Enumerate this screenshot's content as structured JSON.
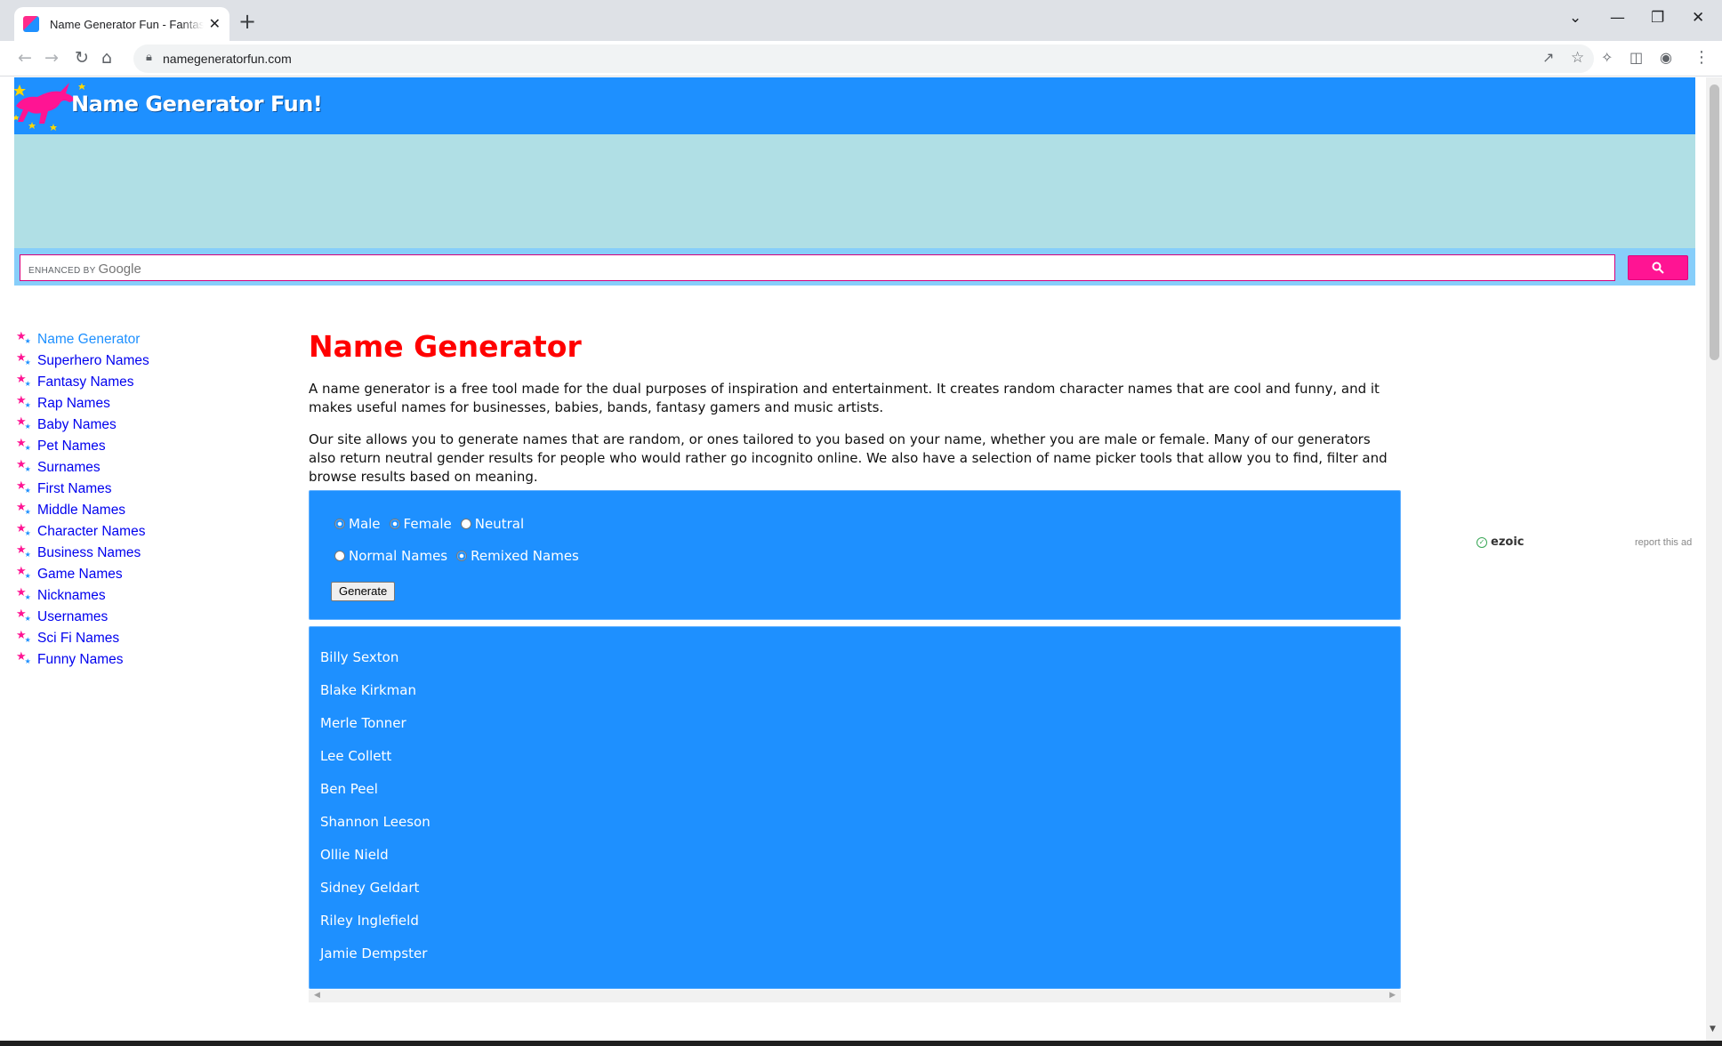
{
  "browser": {
    "tab_title": "Name Generator Fun - Fantasy and ...",
    "tab_close": "✕",
    "new_tab": "+",
    "url": "namegeneratorfun.com",
    "win_controls": {
      "dropdown": "⌄",
      "minimize": "—",
      "restore": "❐",
      "close": "✕"
    },
    "icons": [
      "back-icon",
      "forward-icon",
      "reload-icon",
      "home-icon",
      "lock-icon",
      "share-icon",
      "star-icon",
      "extensions-icon",
      "side-panel-icon",
      "profile-icon",
      "menu-icon"
    ]
  },
  "site": {
    "logo_text": "Name Generator Fun!",
    "search": {
      "brand_small": "ENHANCED BY",
      "brand_google": "Google"
    }
  },
  "sidebar": {
    "items": [
      {
        "label": "Name Generator",
        "current": true
      },
      {
        "label": "Superhero Names"
      },
      {
        "label": "Fantasy Names"
      },
      {
        "label": "Rap Names"
      },
      {
        "label": "Baby Names"
      },
      {
        "label": "Pet Names"
      },
      {
        "label": "Surnames"
      },
      {
        "label": "First Names"
      },
      {
        "label": "Middle Names"
      },
      {
        "label": "Character Names"
      },
      {
        "label": "Business Names"
      },
      {
        "label": "Game Names"
      },
      {
        "label": "Nicknames"
      },
      {
        "label": "Usernames"
      },
      {
        "label": "Sci Fi Names"
      },
      {
        "label": "Funny Names"
      }
    ]
  },
  "main": {
    "title": "Name Generator",
    "para1": "A name generator is a free tool made for the dual purposes of inspiration and entertainment. It creates random character names that are cool and funny, and it makes useful names for businesses, babies, bands, fantasy gamers and music artists.",
    "para2": "Our site allows you to generate names that are random, or ones tailored to you based on your name, whether you are male or female. Many of our generators also return neutral gender results for people who would rather go incognito online. We also have a selection of name picker tools that allow you to find, filter and browse results based on meaning.",
    "gender_options": [
      {
        "label": "Male",
        "checked": true
      },
      {
        "label": "Female",
        "checked": true
      },
      {
        "label": "Neutral",
        "checked": false
      }
    ],
    "style_options": [
      {
        "label": "Normal Names",
        "checked": false
      },
      {
        "label": "Remixed Names",
        "checked": true
      }
    ],
    "generate_label": "Generate",
    "results": [
      "Billy Sexton",
      "Blake Kirkman",
      "Merle Tonner",
      "Lee Collett",
      "Ben Peel",
      "Shannon Leeson",
      "Ollie Nield",
      "Sidney Geldart",
      "Riley Inglefield",
      "Jamie Dempster"
    ]
  },
  "ad": {
    "ezoic_label": "ezoic",
    "report_label": "report this ad"
  },
  "colors": {
    "brand_blue": "#1e90ff",
    "accent_pink": "#ff1493",
    "title_red": "#ff0000",
    "ad_band": "#b0dfe5"
  }
}
